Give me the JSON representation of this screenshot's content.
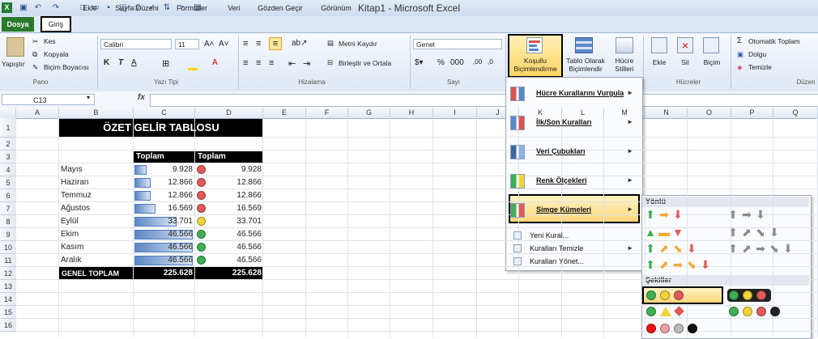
{
  "window": {
    "title": "Kitap1 - Microsoft Excel"
  },
  "quick_access": {
    "undo_icon": "undo-icon",
    "redo_icon": "redo-icon"
  },
  "tabs": [
    {
      "label": "Dosya"
    },
    {
      "label": "Giriş"
    },
    {
      "label": "Ekle"
    },
    {
      "label": "Sayfa Düzeni"
    },
    {
      "label": "Formüller"
    },
    {
      "label": "Veri"
    },
    {
      "label": "Gözden Geçir"
    },
    {
      "label": "Görünüm"
    }
  ],
  "ribbon": {
    "pano": {
      "paste": "Yapıştır",
      "cut": "Kes",
      "copy": "Kopyala",
      "format_painter": "Biçim Boyacısı",
      "label": "Pano"
    },
    "font": {
      "name": "Calibri",
      "size": "11",
      "bold": "K",
      "italic": "T",
      "underline": "A",
      "label": "Yazı Tipi"
    },
    "alignment": {
      "wrap": "Metni Kaydır",
      "merge": "Birleştir ve Ortala",
      "label": "Hizalama"
    },
    "number": {
      "format": "Genel",
      "percent": "%",
      "label": "Sayı"
    },
    "styles": {
      "conditional_line1": "Koşullu",
      "conditional_line2": "Biçimlendirme",
      "table_line1": "Tablo Olarak",
      "table_line2": "Biçimlendir",
      "cell_line1": "Hücre",
      "cell_line2": "Stilleri"
    },
    "cells": {
      "insert": "Ekle",
      "delete": "Sil",
      "format": "Biçim",
      "label": "Hücreler"
    },
    "editing": {
      "autosum": "Otomatik Toplam",
      "fill": "Dolgu",
      "clear": "Temizle",
      "label": "Düzen"
    }
  },
  "formula_bar": {
    "name_box": "C13",
    "fx": "fx",
    "value": ""
  },
  "columns": [
    "A",
    "B",
    "C",
    "D",
    "E",
    "F",
    "G",
    "H",
    "I",
    "J",
    "K",
    "L",
    "M",
    "N",
    "O",
    "P",
    "Q"
  ],
  "rows": [
    "1",
    "2",
    "3",
    "4",
    "5",
    "6",
    "7",
    "8",
    "9",
    "10",
    "11",
    "12",
    "13",
    "14",
    "15",
    "16"
  ],
  "sheet": {
    "title": "ÖZET GELİR TABLOSU",
    "header_c": "Toplam",
    "header_d": "Toplam",
    "data": [
      {
        "month": "Mayıs",
        "c": "9.928",
        "d": "9.928",
        "value": 9928,
        "dot": "#e15a5a"
      },
      {
        "month": "Haziran",
        "c": "12.866",
        "d": "12.866",
        "value": 12866,
        "dot": "#e15a5a"
      },
      {
        "month": "Temmuz",
        "c": "12.866",
        "d": "12.866",
        "value": 12866,
        "dot": "#e15a5a"
      },
      {
        "month": "Ağustos",
        "c": "16.569",
        "d": "16.569",
        "value": 16569,
        "dot": "#e15a5a"
      },
      {
        "month": "Eylül",
        "c": "33.701",
        "d": "33.701",
        "value": 33701,
        "dot": "#f2d33a"
      },
      {
        "month": "Ekim",
        "c": "46.566",
        "d": "46.566",
        "value": 46566,
        "dot": "#3fae55"
      },
      {
        "month": "Kasım",
        "c": "46.566",
        "d": "46.566",
        "value": 46566,
        "dot": "#3fae55"
      },
      {
        "month": "Aralık",
        "c": "46.566",
        "d": "46.566",
        "value": 46566,
        "dot": "#3fae55"
      }
    ],
    "total_label": "GENEL TOPLAM",
    "total_c": "225.628",
    "total_d": "225.628"
  },
  "menu": {
    "items": [
      {
        "label": "Hücre Kurallarını Vurgula",
        "has_sub": true
      },
      {
        "label": "İlk/Son Kuralları",
        "has_sub": true
      },
      {
        "label": "Veri Çubukları",
        "has_sub": true
      },
      {
        "label": "Renk Ölçekleri",
        "has_sub": true
      },
      {
        "label": "Simge Kümeleri",
        "has_sub": true
      }
    ],
    "small_items": [
      {
        "label": "Yeni Kural..."
      },
      {
        "label": "Kuralları Temizle"
      },
      {
        "label": "Kuralları Yönet..."
      }
    ]
  },
  "submenu": {
    "section1": "Yönlü",
    "section2": "Şekiller"
  }
}
